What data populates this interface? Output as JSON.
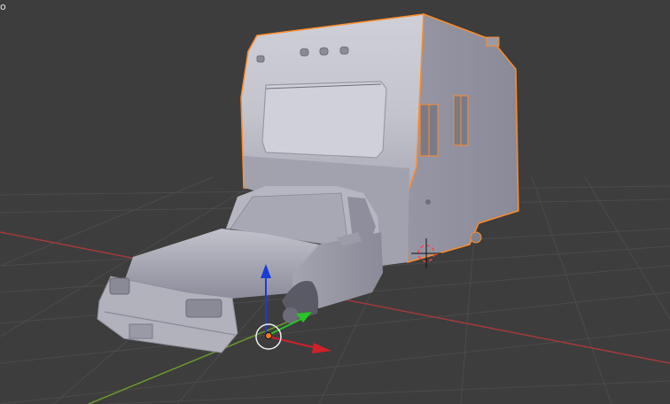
{
  "viewport": {
    "corner_text": "o"
  },
  "colors": {
    "background": "#3d3d3d",
    "grid_line": "#4a4a4a",
    "x_axis": "#a43a3a",
    "y_axis": "#6a9a2a",
    "selection_outline": "#ff8c2a",
    "mesh_light": "#c9c9d3",
    "mesh_mid": "#a3a3b0",
    "mesh_dark": "#7e7e8c"
  },
  "icons": {
    "cursor": "3d-cursor-icon",
    "gizmo": "transform-gizmo-icon",
    "origin": "object-origin-icon"
  },
  "objects": [
    {
      "name": "camper-trailer",
      "selected": true
    },
    {
      "name": "car",
      "selected": false
    }
  ]
}
